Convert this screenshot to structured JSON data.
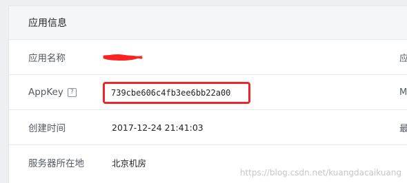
{
  "card": {
    "title": "应用信息"
  },
  "rows": [
    {
      "label": "应用名称",
      "value": "",
      "edge_text": "应"
    },
    {
      "label": "AppKey",
      "help": "?",
      "value": "739cbe606c4fb3ee6bb22a00",
      "edge_text": "M"
    },
    {
      "label": "创建时间",
      "value": "2017-12-24 21:41:03",
      "edge_text": "最"
    },
    {
      "label": "服务器所在地",
      "value": "北京机房",
      "edge_text": ""
    }
  ],
  "watermark": "https://blog.csdn.net/kuangdacaikuang",
  "colors": {
    "highlight_border": "#e8282a",
    "redaction": "#ff2020"
  }
}
